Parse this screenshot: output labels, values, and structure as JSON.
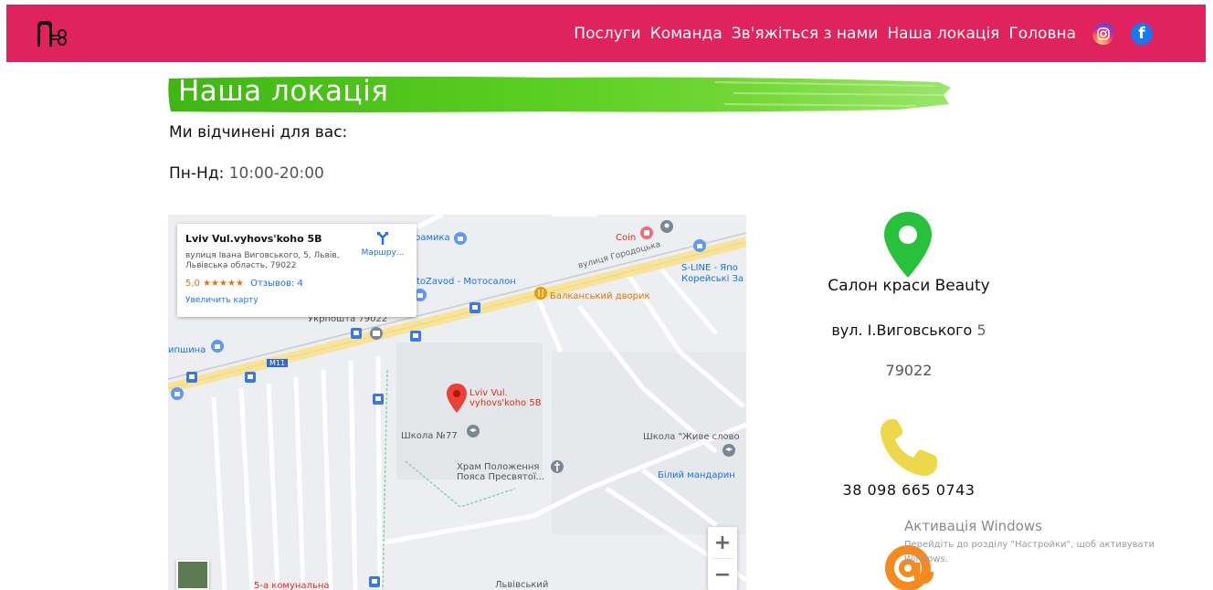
{
  "header": {
    "bg_color": "#e0225f",
    "logo_icon": "scissors-logo-icon",
    "nav": [
      {
        "label": "Послуги"
      },
      {
        "label": "Команда"
      },
      {
        "label": "Зв'яжіться з нами"
      },
      {
        "label": "Наша локація"
      },
      {
        "label": "Головна"
      }
    ],
    "social": [
      {
        "icon": "instagram-icon"
      },
      {
        "icon": "facebook-icon",
        "glyph": "f"
      }
    ]
  },
  "location": {
    "title": "Наша локація",
    "banner_color": "#4cc51d",
    "open_text": "Ми відчинені для вас:",
    "hours_label": "Пн-Нд:",
    "hours_value": "10:00-20:00"
  },
  "map": {
    "card": {
      "place_name": "Lviv Vul.vyhovs'koho 5B",
      "address": "вулиця Івана Виговського, 5, Львів, Львівська область, 79022",
      "rating": "5,0",
      "stars": "★★★★★",
      "reviews": "Отзывов: 4",
      "enlarge": "Увеличить карту",
      "route": "Маршру..."
    },
    "labels": {
      "coin": "Coin",
      "ceramika": "рамика",
      "motozavod": "toZavod - Мотосалон",
      "balkanskyi": "Балканський дворик",
      "sline": "S-LINE - Япо",
      "koreiski": "Корейські За",
      "gorodotska": "вулиця Городоцька",
      "ukrposhta": "Укрпошта 79022",
      "shyna": "ипшина",
      "m11": "M11",
      "marker": "Lviv Vul. vyhovs'koho 5B",
      "school77": "Школа №77",
      "zhyve": "Школа \"Живе слово",
      "khram": "Храм Положення Пояса Пресвятої...",
      "bilyi": "Білий мандарин",
      "lvivskyi": "Львівський",
      "komunalna": "5-а комунальна"
    },
    "zoom_in": "+",
    "zoom_out": "−"
  },
  "contact": {
    "salon_name": "Салон краси Beauty",
    "street": "вул. І.Виговського",
    "street_number": "5",
    "zip": "79022",
    "phone": "38 098 665 0743",
    "pin_color": "#27c13c",
    "phone_color": "#ecd84a",
    "email_color": "#f58b1f"
  },
  "windows_watermark": {
    "title": "Активація Windows",
    "subtitle": "Перейдіть до розділу \"Настройки\", щоб активувати Windows."
  }
}
